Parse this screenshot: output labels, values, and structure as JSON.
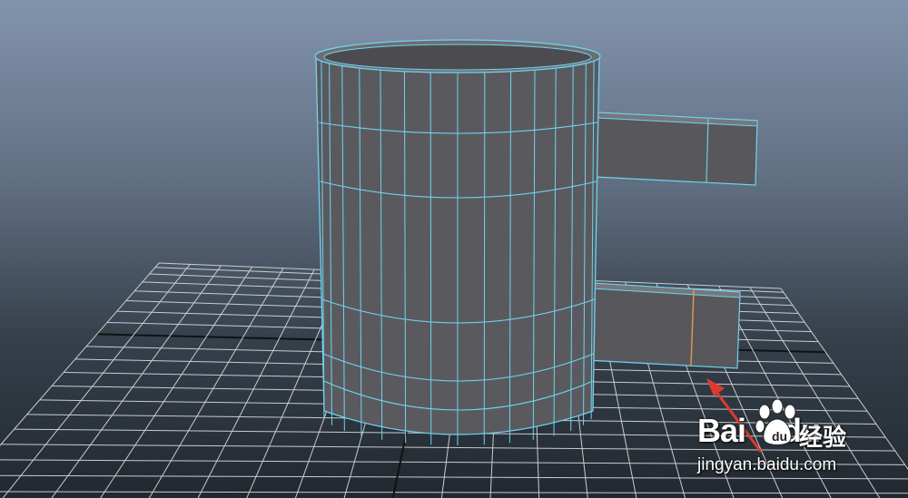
{
  "viewport": {
    "background_top": "#8294ad",
    "background_bottom": "#22282f"
  },
  "colors": {
    "wireframe": "#6fd3f0",
    "selected_edge": "#e39a50",
    "grid_line": "#c8ccd0",
    "grid_axis": "#111111",
    "mesh_fill": "#57575b",
    "arrow": "#e03a2e"
  },
  "watermark": {
    "brand_prefix": "Bai",
    "brand_suffix": "du",
    "chinese": "经验",
    "url": "jingyan.baidu.com",
    "icon": "baidu-paw-icon"
  }
}
